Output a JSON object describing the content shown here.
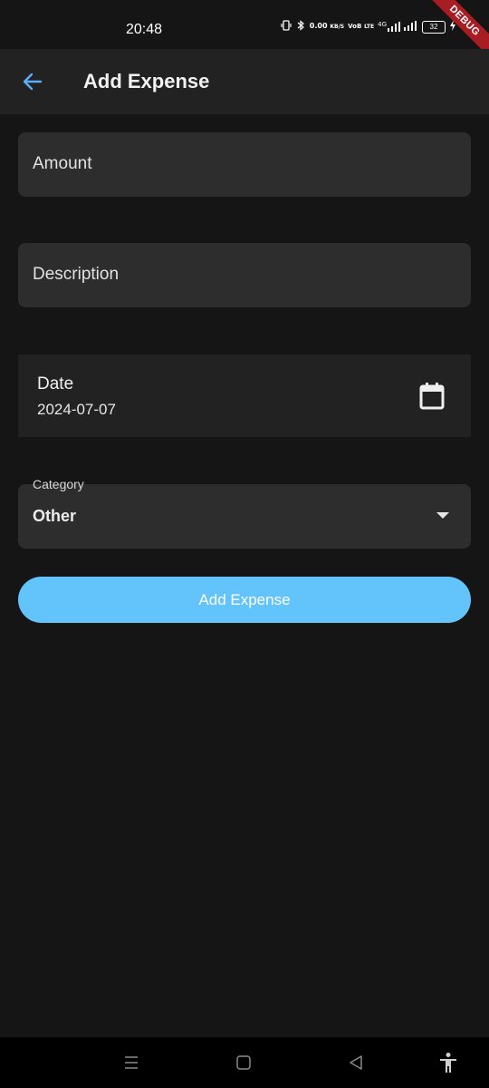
{
  "status_bar": {
    "time": "20:48",
    "net_speed_value": "0.00",
    "net_speed_unit": "KB/S",
    "volte_top": "VoB",
    "volte_bottom": "LTE",
    "network_type": "4G",
    "battery_level": "32",
    "debug_banner": "DEBUG"
  },
  "app_bar": {
    "title": "Add Expense",
    "back_icon": "arrow-back-icon"
  },
  "form": {
    "amount_label": "Amount",
    "description_label": "Description",
    "date_title": "Date",
    "date_value": "2024-07-07",
    "calendar_icon": "calendar-icon",
    "category_label": "Category",
    "category_value": "Other",
    "dropdown_icon": "arrow-drop-down-icon",
    "submit_label": "Add Expense"
  },
  "nav_bar": {
    "icons": [
      "menu-icon",
      "home-icon",
      "back-icon",
      "accessibility-icon"
    ]
  },
  "colors": {
    "background": "#151515",
    "app_bar": "#222222",
    "field": "#2d2d2d",
    "accent": "#63c3fb",
    "back_arrow": "#5aaefc"
  }
}
